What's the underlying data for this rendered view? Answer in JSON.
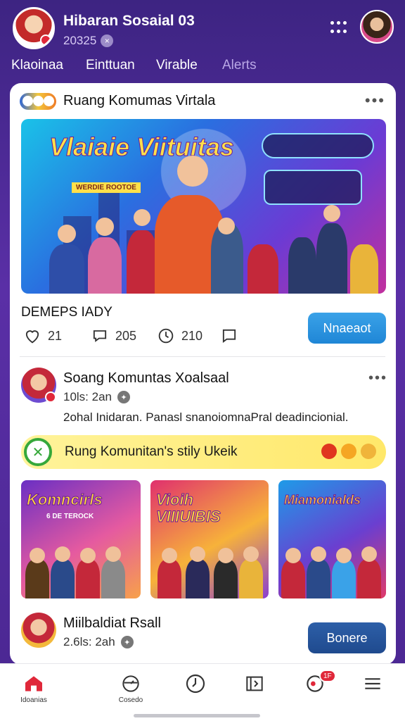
{
  "header": {
    "title": "Hibaran Sosaial 03",
    "subtitle": "20325",
    "subtitle_icon": "close-circle-icon",
    "menu_icon": "grid-dots-icon"
  },
  "nav_tabs": [
    {
      "label": "Klaoinaa"
    },
    {
      "label": "Einttuan"
    },
    {
      "label": "Virable"
    },
    {
      "label": "Alerts"
    }
  ],
  "post1": {
    "title": "Ruang Komumas Virtala",
    "hero_title": "Vlaiaie Viituitas",
    "hero_tag": "WERDIE ROOTOE",
    "caption": "DEMEPS IADY",
    "reactions": [
      {
        "icon": "heart-icon",
        "count": "21"
      },
      {
        "icon": "comment-bubble-icon",
        "count": "205"
      },
      {
        "icon": "clock-icon",
        "count": "210"
      },
      {
        "icon": "chat-square-icon",
        "count": ""
      }
    ],
    "action_label": "Nnaeaot"
  },
  "post2": {
    "title": "Soang Komuntas Xoalsaal",
    "meta": "10ls: 2an",
    "text": "2ohal Inidaran. Panasl snanoiomnaPral deadincionial.",
    "banner_text": "Rung Komunitan's stily Ukeik",
    "thumbnails": [
      {
        "label": "Komncirls",
        "sub": "6 DE TEROCK"
      },
      {
        "label": "Vioih VIIIUIBIS",
        "sub": ""
      },
      {
        "label": "Miamonialds",
        "sub": ""
      }
    ]
  },
  "post3": {
    "title": "Miilbaldiat Rsall",
    "meta": "2.6ls: 2ah",
    "action_label": "Bonere"
  },
  "bottom_nav": [
    {
      "label": "Idoanias",
      "icon": "home-icon"
    },
    {
      "label": "Cosedo",
      "icon": "gauge-icon"
    },
    {
      "label": "",
      "icon": "clock-icon"
    },
    {
      "label": "",
      "icon": "map-icon"
    },
    {
      "label": "",
      "icon": "notifications-icon",
      "badge": "1F"
    },
    {
      "label": "",
      "icon": "menu-icon"
    }
  ],
  "colors": {
    "header_bg": "#4a2a8c",
    "primary_button": "#2a8fd8",
    "secondary_button": "#25529b",
    "banner_bg": "#fff07a",
    "home_active": "#e0283a"
  }
}
